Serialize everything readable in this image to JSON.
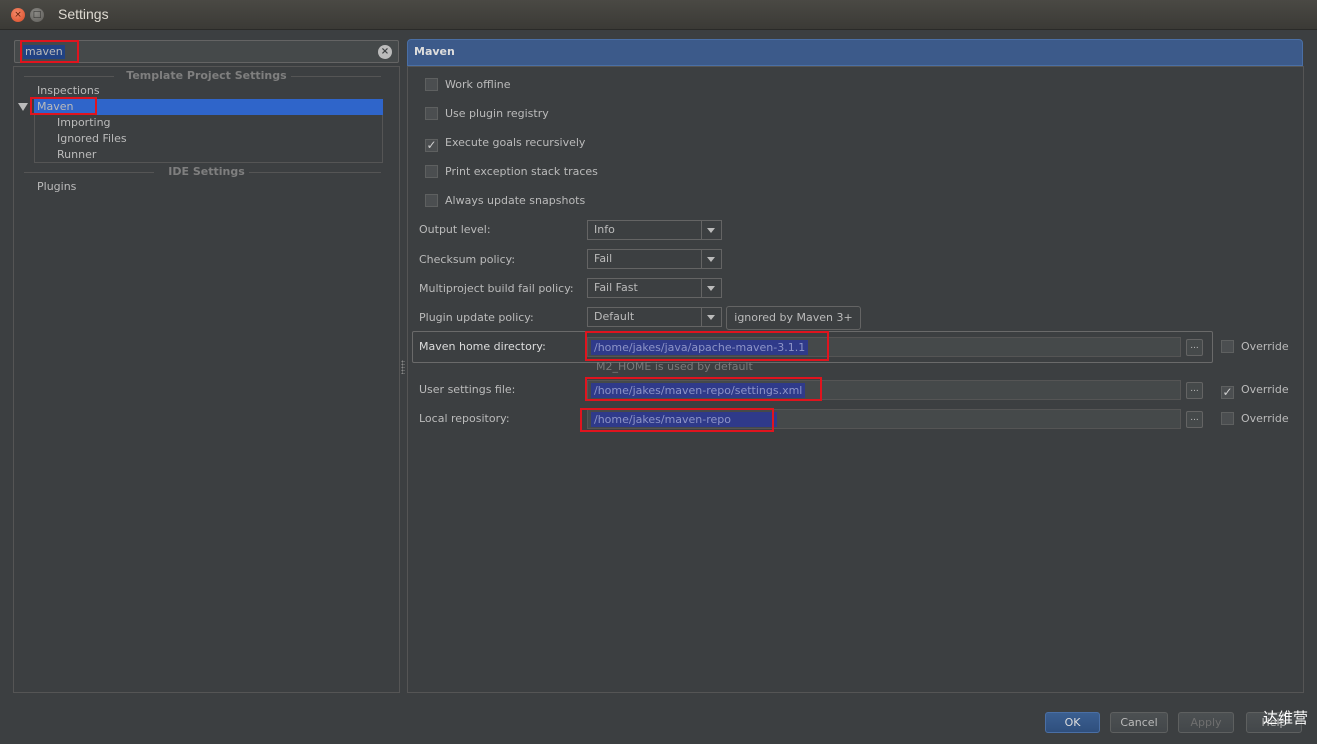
{
  "window": {
    "title": "Settings",
    "close_glyph": "×",
    "max_glyph": "□"
  },
  "search": {
    "value": "maven",
    "clear_glyph": "×"
  },
  "tree": {
    "sections": [
      "Template Project Settings",
      "IDE Settings"
    ],
    "items": {
      "inspections": "Inspections",
      "maven": "Maven",
      "importing": "Importing",
      "ignored_files": "Ignored Files",
      "runner": "Runner",
      "plugins": "Plugins"
    }
  },
  "panel": {
    "title": "Maven",
    "checkboxes": [
      {
        "label": "Work offline",
        "checked": false
      },
      {
        "label": "Use plugin registry",
        "checked": false
      },
      {
        "label": "Execute goals recursively",
        "checked": true
      },
      {
        "label": "Print exception stack traces",
        "checked": false
      },
      {
        "label": "Always update snapshots",
        "checked": false
      }
    ],
    "check_glyph": "✓",
    "output_level": {
      "label": "Output level:",
      "value": "Info"
    },
    "checksum_policy": {
      "label": "Checksum policy:",
      "value": "Fail"
    },
    "fail_policy": {
      "label": "Multiproject build fail policy:",
      "value": "Fail Fast"
    },
    "plugin_update": {
      "label": "Plugin update policy:",
      "value": "Default",
      "note": "ignored by Maven 3+"
    },
    "maven_home": {
      "label": "Maven home directory:",
      "value": "/home/jakes/java/apache-maven-3.1.1",
      "hint": "M2_HOME is used by default",
      "override": false
    },
    "settings_file": {
      "label": "User settings file:",
      "value": "/home/jakes/maven-repo/settings.xml",
      "override": true
    },
    "local_repo": {
      "label": "Local repository:",
      "value": "/home/jakes/maven-repo",
      "override": false
    },
    "override_label": "Override",
    "dots": "..."
  },
  "buttons": {
    "ok": "OK",
    "cancel": "Cancel",
    "apply": "Apply",
    "help": "Help"
  },
  "watermark": "达维营"
}
